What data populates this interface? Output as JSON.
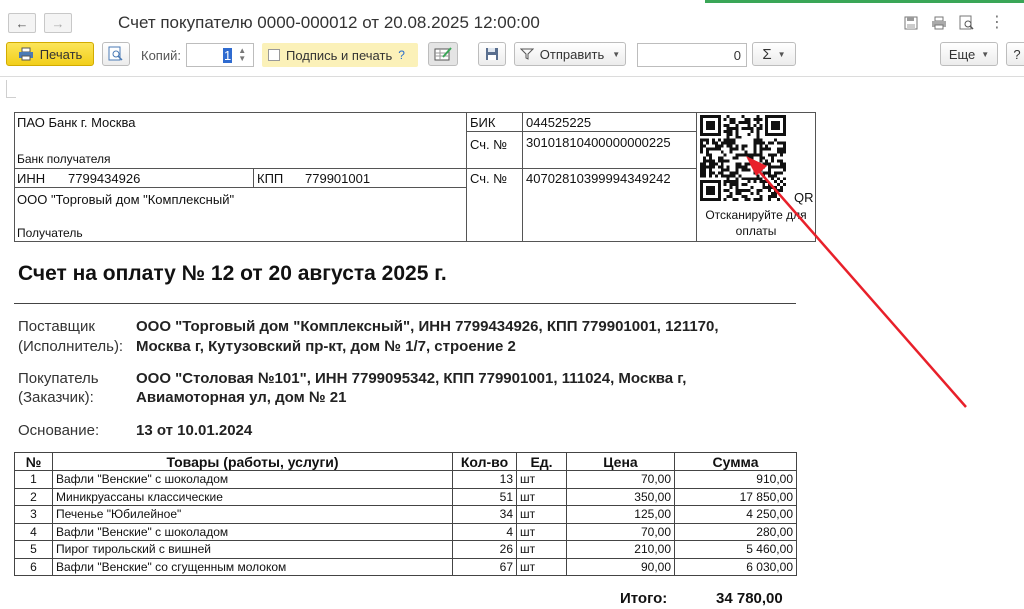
{
  "window": {
    "title": "Счет покупателю 0000-000012 от 20.08.2025 12:00:00"
  },
  "toolbar": {
    "print_label": "Печать",
    "copies_label": "Копий:",
    "copies_value": "1",
    "sign_print_label": "Подпись и печать",
    "help_mark": "?",
    "send_label": "Отправить",
    "sum_value": "0",
    "sigma_label": "Σ",
    "more_label": "Еще",
    "help_button_label": "?"
  },
  "bank": {
    "bank_name": "ПАО Банк г. Москва",
    "bank_caption": "Банк получателя",
    "bik_label": "БИК",
    "bik_value": "044525225",
    "corr_label": "Сч. №",
    "corr_value": "30101810400000000225",
    "inn_label": "ИНН",
    "inn_value": "7799434926",
    "kpp_label": "КПП",
    "kpp_value": "779901001",
    "acc_label": "Сч. №",
    "acc_value": "40702810399994349242",
    "recipient_name": "ООО \"Торговый дом \"Комплексный\"",
    "recipient_caption": "Получатель",
    "qr_tag": "QR",
    "qr_caption_1": "Отсканируйте для",
    "qr_caption_2": "оплаты"
  },
  "invoice": {
    "heading": "Счет на оплату № 12 от 20 августа 2025 г.",
    "supplier_label_1": "Поставщик",
    "supplier_label_2": "(Исполнитель):",
    "supplier_value_1": "ООО \"Торговый дом \"Комплексный\", ИНН 7799434926, КПП 779901001, 121170,",
    "supplier_value_2": "Москва г, Кутузовский пр-кт, дом № 1/7, строение 2",
    "buyer_label_1": "Покупатель",
    "buyer_label_2": "(Заказчик):",
    "buyer_value_1": "ООО \"Столовая №101\", ИНН 7799095342, КПП 779901001, 111024, Москва г,",
    "buyer_value_2": "Авиамоторная ул, дом № 21",
    "basis_label": "Основание:",
    "basis_value": "13 от 10.01.2024"
  },
  "table": {
    "headers": [
      "№",
      "Товары (работы, услуги)",
      "Кол-во",
      "Ед.",
      "Цена",
      "Сумма"
    ],
    "rows": [
      {
        "n": "1",
        "name": "Вафли \"Венские\" с шоколадом",
        "qty": "13",
        "unit": "шт",
        "price": "70,00",
        "sum": "910,00"
      },
      {
        "n": "2",
        "name": "Миникруассаны классические",
        "qty": "51",
        "unit": "шт",
        "price": "350,00",
        "sum": "17 850,00"
      },
      {
        "n": "3",
        "name": "Печенье \"Юбилейное\"",
        "qty": "34",
        "unit": "шт",
        "price": "125,00",
        "sum": "4 250,00"
      },
      {
        "n": "4",
        "name": "Вафли \"Венские\" с шоколадом",
        "qty": "4",
        "unit": "шт",
        "price": "70,00",
        "sum": "280,00"
      },
      {
        "n": "5",
        "name": "Пирог тирольский с вишней",
        "qty": "26",
        "unit": "шт",
        "price": "210,00",
        "sum": "5 460,00"
      },
      {
        "n": "6",
        "name": "Вафли \"Венские\" со сгущенным молоком",
        "qty": "67",
        "unit": "шт",
        "price": "90,00",
        "sum": "6 030,00"
      }
    ],
    "total_label": "Итого:",
    "total_value": "34 780,00"
  },
  "colors": {
    "accent": "#3aa657",
    "print_button": "#f2cf1a",
    "sign_highlight": "#fbf1b9",
    "annotation_arrow": "#e8202a"
  },
  "icons": {
    "back": "arrow-left-icon",
    "forward": "arrow-right-icon",
    "save": "floppy-disk-icon",
    "printer": "printer-icon",
    "preview": "magnifier-page-icon",
    "more": "vertical-dots-icon"
  }
}
